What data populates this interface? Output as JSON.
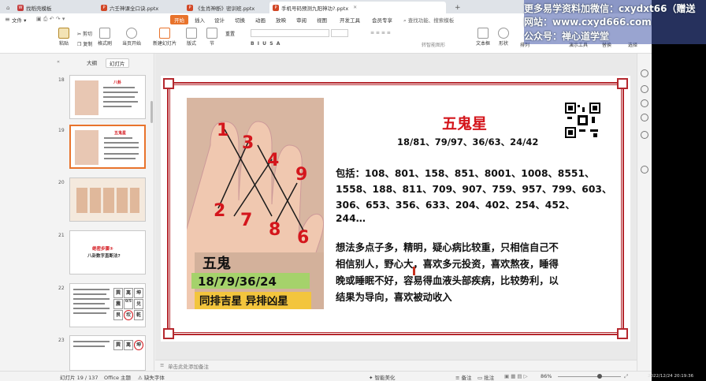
{
  "tabs": [
    {
      "label": "找稻壳模板",
      "type": "wps"
    },
    {
      "label": "六壬神课全口诀.pptx",
      "type": "ppt"
    },
    {
      "label": "《生肖神断》密训班.pptx",
      "type": "ppt"
    },
    {
      "label": "手机号码预测九阳神功?.pptx",
      "type": "ppt",
      "active": true
    }
  ],
  "menu": {
    "file": "文件",
    "items": [
      "开始",
      "插入",
      "设计",
      "切换",
      "动画",
      "放映",
      "审阅",
      "视图",
      "开发工具",
      "会员专享"
    ],
    "selected": "开始",
    "search": "查找功能、搜索模板"
  },
  "ribbon": {
    "paste": "粘贴",
    "cut": "剪切",
    "copy": "复制",
    "format_painter": "格式刷",
    "from_current": "当页开始",
    "new_slide": "新建幻灯片",
    "layout": "版式",
    "section": "节",
    "reset": "重置",
    "text_box": "文本框",
    "shape": "形状",
    "arrange": "排列",
    "presentation_tools": "演示工具",
    "replace": "替换",
    "select": "选择",
    "text_to_smartart": "转智能图形"
  },
  "left_panel": {
    "tab_outline": "大纲",
    "tab_slides": "幻灯片",
    "thumbs": [
      {
        "no": "18",
        "title": "八卦"
      },
      {
        "no": "19",
        "title": "五鬼星"
      },
      {
        "no": "20",
        "title": ""
      },
      {
        "no": "21",
        "title": "绝密步骤③",
        "subtitle": "八卦数字直断法?"
      },
      {
        "no": "22",
        "title": ""
      },
      {
        "no": "23",
        "title": ""
      }
    ],
    "grid22": [
      "巽",
      "离",
      "坤",
      "震",
      "0/5",
      "兑",
      "艮",
      "坎",
      "乾"
    ],
    "grid23": [
      "巽",
      "离",
      "坤"
    ]
  },
  "slide": {
    "title": "五鬼星",
    "subtitle": "18/81、79/97、36/63、24/42",
    "includes": [
      "包括：108、801、158、851、8001、1008、8551、",
      "1558、188、811、709、907、759、957、799、603、",
      "306、653、356、633、204、402、254、452、",
      "244…"
    ],
    "desc": [
      "想法多点子多，精明，疑心病比较重，只相信自己不",
      "相信别人，野心大，喜欢多元投资，喜欢熬夜，睡得",
      "晚或睡眠不好，容易得血液头部疾病，比较势利，以",
      "结果为导向，喜欢被动收入"
    ],
    "hand": {
      "numbers": [
        "1",
        "3",
        "4",
        "9",
        "2",
        "7",
        "8",
        "6"
      ],
      "label": "五鬼",
      "code": "18/79/36/24",
      "banner": "同排吉星 异排凶星",
      "colors": {
        "number": "#d4161c",
        "line": "#1a1a1a",
        "code_bg": "#a5d26b",
        "banner_bg": "#f3c53d"
      }
    }
  },
  "notes": "单击此处添加备注",
  "status": {
    "slide_no": "幻灯片 19 / 137",
    "theme": "Office 主题",
    "font_missing": "缺失字体",
    "smart": "智能美化",
    "notes_btn": "备注",
    "comment": "批注",
    "zoom": "86%"
  },
  "overlay": {
    "line1": "更多易学资料加微信：cxydxt66（赠送",
    "line2": "网站：www.cxyd666.com",
    "line3": "公众号：禅心道学堂",
    "date": "2022/12/24 20:19:36"
  },
  "colors": {
    "accent": "#e8732c",
    "slide_red": "#d4161c",
    "frame_red": "#b5282e"
  }
}
